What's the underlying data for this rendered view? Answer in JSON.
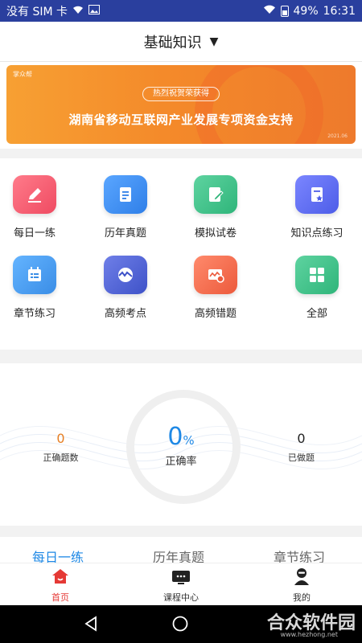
{
  "status_bar": {
    "carrier": "没有 SIM 卡",
    "battery": "49%",
    "time": "16:31",
    "icons": [
      "wifi-icon",
      "image-icon",
      "wifi-icon",
      "battery-icon"
    ]
  },
  "header": {
    "title": "基础知识"
  },
  "banner": {
    "logo_text": "掌众帮",
    "pill": "热烈祝贺荣获得",
    "text": "湖南省移动互联网产业发展专项资金支持",
    "mark": "2021.06"
  },
  "grid": {
    "items": [
      {
        "label": "每日一练",
        "icon": "pencil-icon",
        "color": "#f2566b"
      },
      {
        "label": "历年真题",
        "icon": "document-icon",
        "color": "#3d8ef0"
      },
      {
        "label": "模拟试卷",
        "icon": "exam-icon",
        "color": "#3cc08a"
      },
      {
        "label": "知识点练习",
        "icon": "book-star-icon",
        "color": "#5b6cf0"
      },
      {
        "label": "章节练习",
        "icon": "calendar-list-icon",
        "color": "#4aa0ee"
      },
      {
        "label": "高频考点",
        "icon": "wave-icon",
        "color": "#5166d8"
      },
      {
        "label": "高频错题",
        "icon": "chart-error-icon",
        "color": "#f26a4f"
      },
      {
        "label": "全部",
        "icon": "grid-icon",
        "color": "#3cc08a"
      }
    ]
  },
  "stats": {
    "correct_count": "0",
    "correct_count_label": "正确题数",
    "rate_value": "0",
    "rate_unit": "%",
    "rate_label": "正确率",
    "done_count": "0",
    "done_count_label": "已做题"
  },
  "quick_tabs": [
    "每日一练",
    "历年真题",
    "章节练习"
  ],
  "bottom_nav": {
    "items": [
      {
        "label": "首页",
        "icon": "home-icon"
      },
      {
        "label": "课程中心",
        "icon": "tv-icon"
      },
      {
        "label": "我的",
        "icon": "user-icon"
      }
    ]
  },
  "watermark": {
    "text": "合众软件园",
    "url": "www.hezhong.net"
  },
  "colors": {
    "status_bar": "#2a3f9e",
    "accent": "#1e88e5",
    "active_nav": "#e53935",
    "correct_count": "#e67e22"
  }
}
